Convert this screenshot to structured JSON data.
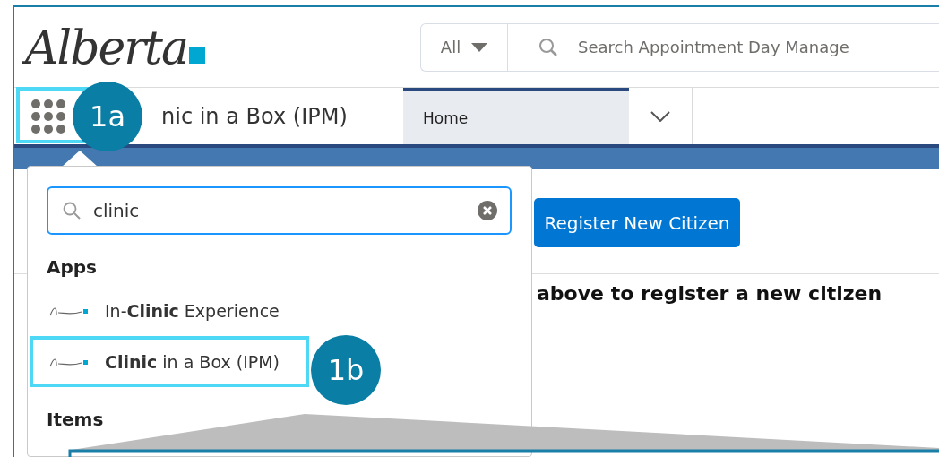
{
  "header": {
    "logo": "Alberta",
    "search": {
      "scope": "All",
      "placeholder": "Search Appointment Day Manage"
    }
  },
  "nav": {
    "app_name": "nic in a Box (IPM)",
    "tabs": [
      {
        "label": "Home",
        "selected": true
      }
    ]
  },
  "content": {
    "button": "Register New Citizen",
    "instruction": "above to register a new citizen"
  },
  "app_launcher": {
    "search_value": "clinic",
    "sections": [
      {
        "heading": "Apps",
        "items": [
          {
            "label": "In-**Clinic** Experience",
            "selected": false
          },
          {
            "label": "**Clinic** in a Box (IPM)",
            "selected": true
          }
        ]
      },
      {
        "heading": "Items"
      }
    ]
  },
  "callouts": [
    {
      "label": "1a"
    },
    {
      "label": "1b"
    }
  ]
}
